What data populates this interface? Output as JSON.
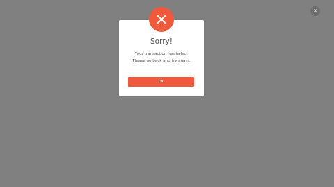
{
  "close_button": {
    "icon": "close-icon",
    "label": "×"
  },
  "dialog": {
    "status_icon": "error-x-icon",
    "accent_color": "#ef5a3c",
    "title": "Sorry!",
    "message_line_1": "Your transaction has failed.",
    "message_line_2": "Please go back and try again.",
    "ok_label": "OK"
  }
}
